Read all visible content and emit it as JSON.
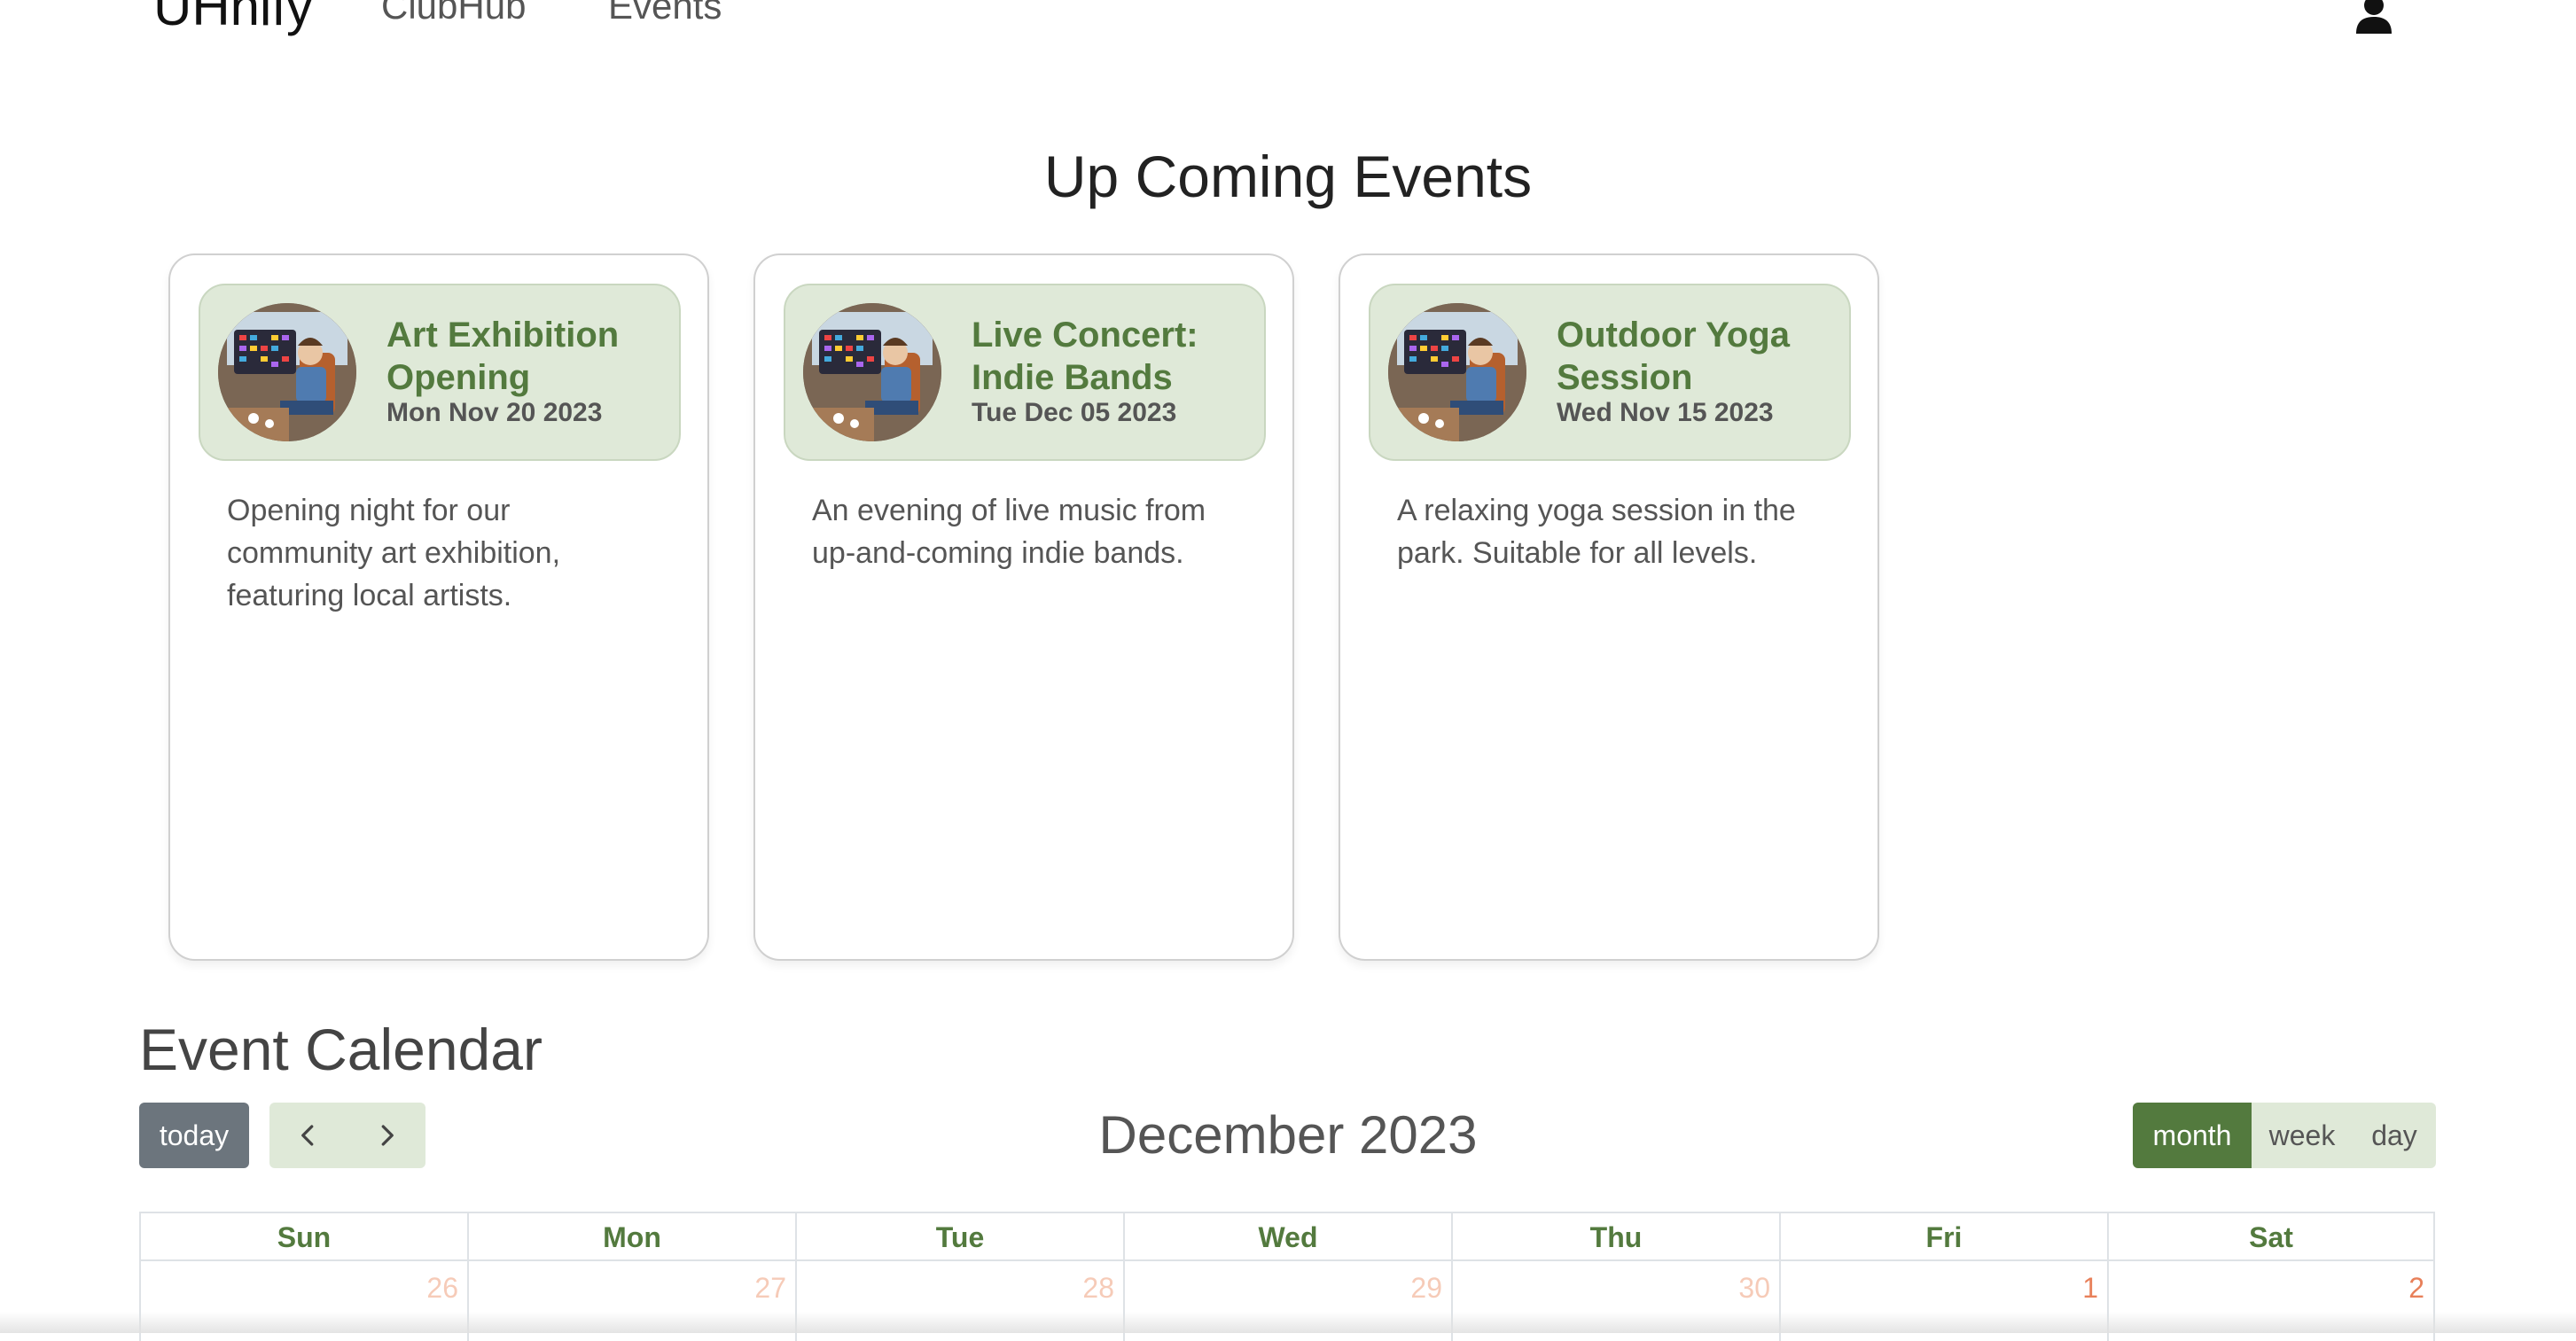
{
  "navbar": {
    "brand": "UHnify",
    "links": [
      {
        "label": "ClubHub"
      },
      {
        "label": "Events"
      }
    ],
    "user_icon": "user-icon"
  },
  "upcoming": {
    "title": "Up Coming Events",
    "events": [
      {
        "title_line1": "Art Exhibition",
        "title_line2": "Opening",
        "date": "Mon Nov 20 2023",
        "description": "Opening night for our community art exhibition, featuring local artists."
      },
      {
        "title_line1": "Live Concert:",
        "title_line2": "Indie Bands",
        "date": "Tue Dec 05 2023",
        "description": "An evening of live music from up-and-coming indie bands."
      },
      {
        "title_line1": "Outdoor Yoga",
        "title_line2": "Session",
        "date": "Wed Nov 15 2023",
        "description": "A relaxing yoga session in the park. Suitable for all levels."
      }
    ]
  },
  "calendar": {
    "title": "Event Calendar",
    "today_label": "today",
    "prev_icon": "chevron-left-icon",
    "next_icon": "chevron-right-icon",
    "month_title": "December 2023",
    "views": [
      {
        "label": "month",
        "active": true
      },
      {
        "label": "week",
        "active": false
      },
      {
        "label": "day",
        "active": false
      }
    ],
    "weekdays": [
      "Sun",
      "Mon",
      "Tue",
      "Wed",
      "Thu",
      "Fri",
      "Sat"
    ],
    "first_week": [
      "26",
      "27",
      "28",
      "29",
      "30",
      "1",
      "2"
    ]
  },
  "colors": {
    "accent_green": "#537a3e",
    "card_header_bg": "#dfe9d8",
    "today_button": "#6c757d",
    "date_current_month": "#e8805a",
    "date_other_month": "#f6cbb8"
  }
}
